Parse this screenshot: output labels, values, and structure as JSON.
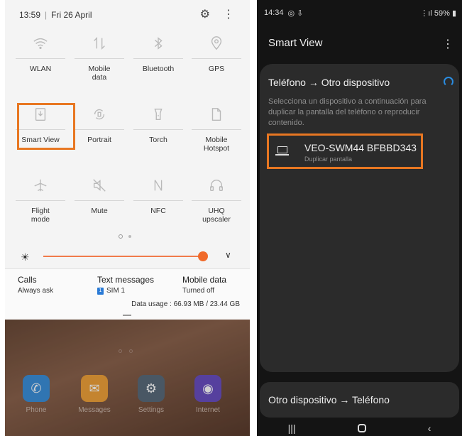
{
  "left": {
    "status": {
      "time": "13:59",
      "date": "Fri 26 April"
    },
    "tiles": [
      {
        "label": "WLAN",
        "icon": "wifi-icon"
      },
      {
        "label": "Mobile\ndata",
        "icon": "mobile-data-icon"
      },
      {
        "label": "Bluetooth",
        "icon": "bluetooth-icon"
      },
      {
        "label": "GPS",
        "icon": "location-icon"
      },
      {
        "label": "Smart View",
        "icon": "smart-view-icon"
      },
      {
        "label": "Portrait",
        "icon": "rotate-icon"
      },
      {
        "label": "Torch",
        "icon": "torch-icon"
      },
      {
        "label": "Mobile\nHotspot",
        "icon": "hotspot-icon"
      },
      {
        "label": "Flight\nmode",
        "icon": "airplane-icon"
      },
      {
        "label": "Mute",
        "icon": "mute-icon"
      },
      {
        "label": "NFC",
        "icon": "nfc-icon"
      },
      {
        "label": "UHQ\nupscaler",
        "icon": "headphones-icon"
      }
    ],
    "usage": {
      "calls_label": "Calls",
      "calls_value": "Always ask",
      "text_label": "Text messages",
      "text_value": "SIM 1",
      "sim_badge": "1",
      "data_label": "Mobile data",
      "data_value": "Turned off",
      "data_usage": "Data usage : 66.93 MB / 23.44 GB"
    },
    "home_apps": [
      {
        "name": "Phone",
        "color": "#3b8fd9"
      },
      {
        "name": "Messages",
        "color": "#f0a23a"
      },
      {
        "name": "Settings",
        "color": "#5a6b7a"
      },
      {
        "name": "Internet",
        "color": "#6a4fc1"
      }
    ]
  },
  "right": {
    "status": {
      "time": "14:34",
      "battery": "59%"
    },
    "title": "Smart View",
    "section_title": "Teléfono → Otro dispositivo",
    "description": "Selecciona un dispositivo a continuación para duplicar la pantalla del teléfono o reproducir contenido.",
    "device": {
      "name": "VEO-SWM44 BFBBD343",
      "sub": "Duplicar pantalla"
    },
    "bottom_label": "Otro dispositivo → Teléfono"
  },
  "accent": "#e87722"
}
